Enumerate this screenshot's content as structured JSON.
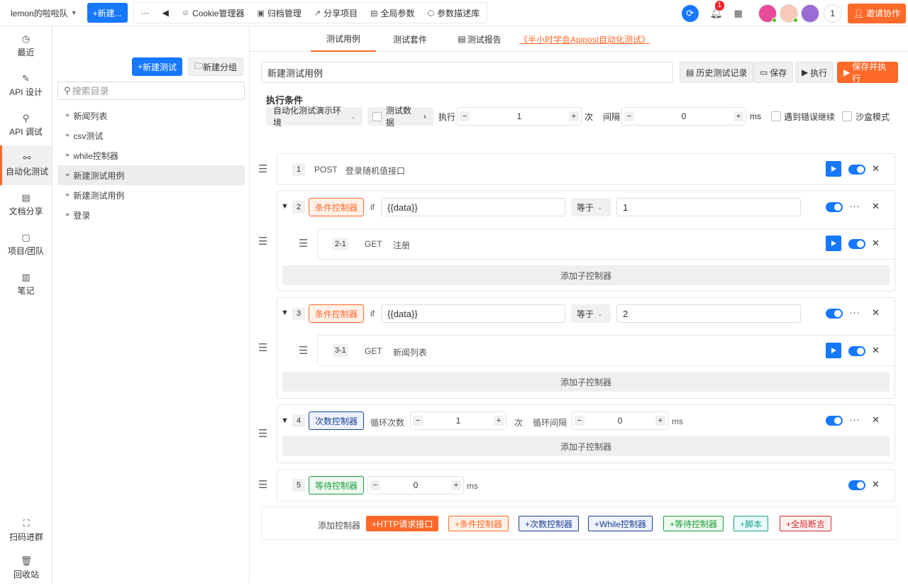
{
  "topbar": {
    "team": "lemon的啦啦队",
    "new_button": "+新建...",
    "tools": [
      "Cookie管理器",
      "归档管理",
      "分享项目",
      "全局参数",
      "参数描述库"
    ],
    "notification_count": "1",
    "member_count": "1",
    "invite": "邀请协作"
  },
  "nav": {
    "items": [
      "最近",
      "API 设计",
      "API 调试",
      "自动化测试",
      "文档分享",
      "项目/团队",
      "笔记"
    ],
    "active": "自动化测试",
    "bottom": [
      "扫码进群",
      "回收站"
    ]
  },
  "directory": {
    "new_test": "新建测试",
    "new_group": "新建分组",
    "search_placeholder": "搜索目录",
    "items": [
      "新闻列表",
      "csv测试",
      "while控制器",
      "新建测试用例",
      "新建测试用例",
      "登录"
    ],
    "active_index": 3
  },
  "tabs": [
    "测试用例",
    "测试套件",
    "测试报告",
    "《半小时学会Apipost自动化测试》"
  ],
  "case": {
    "name": "新建测试用例",
    "history": "历史测试记录",
    "save": "保存",
    "run": "执行",
    "save_run": "保存并执行"
  },
  "conditions": {
    "title": "执行条件",
    "env": "自动化测试演示环境",
    "test_data": "测试数据",
    "run_label": "执行",
    "run_times": "1",
    "times_unit": "次",
    "interval_label": "间隔",
    "interval": "0",
    "ms": "ms",
    "continue_on_error": "遇到错误继续",
    "sandbox": "沙盒模式"
  },
  "steps": {
    "s1": {
      "num": "1",
      "method": "POST",
      "name": "登录随机值接口"
    },
    "s2": {
      "num": "2",
      "tag": "条件控制器",
      "if": "if",
      "var": "{{data}}",
      "op": "等于",
      "value": "1",
      "child": {
        "num": "2-1",
        "method": "GET",
        "name": "注册"
      },
      "add_child": "添加子控制器"
    },
    "s3": {
      "num": "3",
      "tag": "条件控制器",
      "if": "if",
      "var": "{{data}}",
      "op": "等于",
      "value": "2",
      "child": {
        "num": "3-1",
        "method": "GET",
        "name": "新闻列表"
      },
      "add_child": "添加子控制器"
    },
    "s4": {
      "num": "4",
      "tag": "次数控制器",
      "loop_label": "循环次数",
      "loop_count": "1",
      "times_unit": "次",
      "interval_label": "循环间隔",
      "interval": "0",
      "ms": "ms",
      "add_child": "添加子控制器"
    },
    "s5": {
      "num": "5",
      "tag": "等待控制器",
      "wait": "0",
      "ms": "ms"
    }
  },
  "add_controllers": {
    "label": "添加控制器",
    "buttons": [
      "+HTTP请求接口",
      "+条件控制器",
      "+次数控制器",
      "+While控制器",
      "+等待控制器",
      "+脚本",
      "+全局断言"
    ]
  },
  "colors": {
    "accent": "#ff6a2a",
    "primary": "#1677ff"
  }
}
